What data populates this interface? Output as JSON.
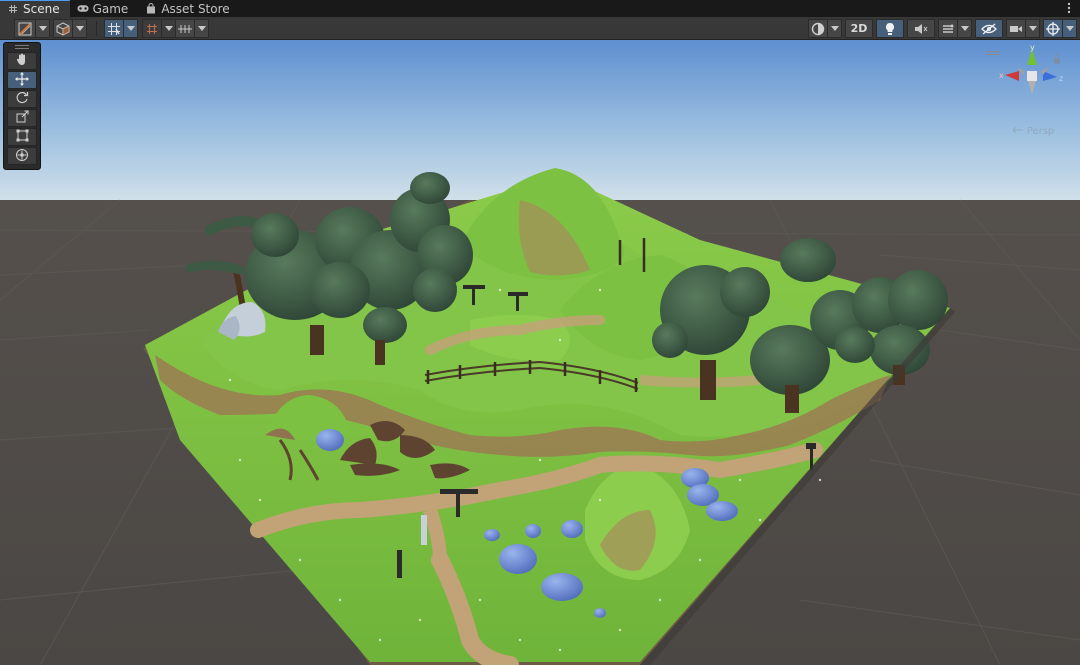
{
  "tabs": [
    {
      "label": "Scene",
      "icon": "grid-icon",
      "active": true
    },
    {
      "label": "Game",
      "icon": "gamepad-icon",
      "active": false
    },
    {
      "label": "Asset Store",
      "icon": "shopping-bag-icon",
      "active": false
    }
  ],
  "toolbar": {
    "mode_2d_label": "2D",
    "left_buttons": [
      "shading-mode-icon",
      "render-cube-icon",
      "snap-grid-icon",
      "increment-snap-icon",
      "grid-visibility-icon"
    ],
    "right_buttons": [
      "draw-mode-icon",
      "2d-toggle",
      "lighting-icon",
      "audio-icon",
      "effects-icon",
      "hidden-objects-icon",
      "camera-icon",
      "gizmos-icon"
    ]
  },
  "tools": [
    "hand-icon",
    "move-icon",
    "rotate-icon",
    "scale-icon",
    "rect-icon",
    "transform-icon"
  ],
  "active_tool": "move-icon",
  "gizmo": {
    "axes": [
      "x",
      "y",
      "z"
    ],
    "label": "Persp",
    "colors": {
      "x": "#d03a3a",
      "y": "#70c038",
      "z": "#3a6ed8"
    }
  },
  "colors": {
    "accent": "#4d9bf0",
    "sky_top": "#5e8fd0",
    "sky_horizon": "#c6d8e6",
    "ground": "#4d4946",
    "grass": "#7bc242",
    "path": "#b6966a",
    "tree": "#3c5a44"
  }
}
